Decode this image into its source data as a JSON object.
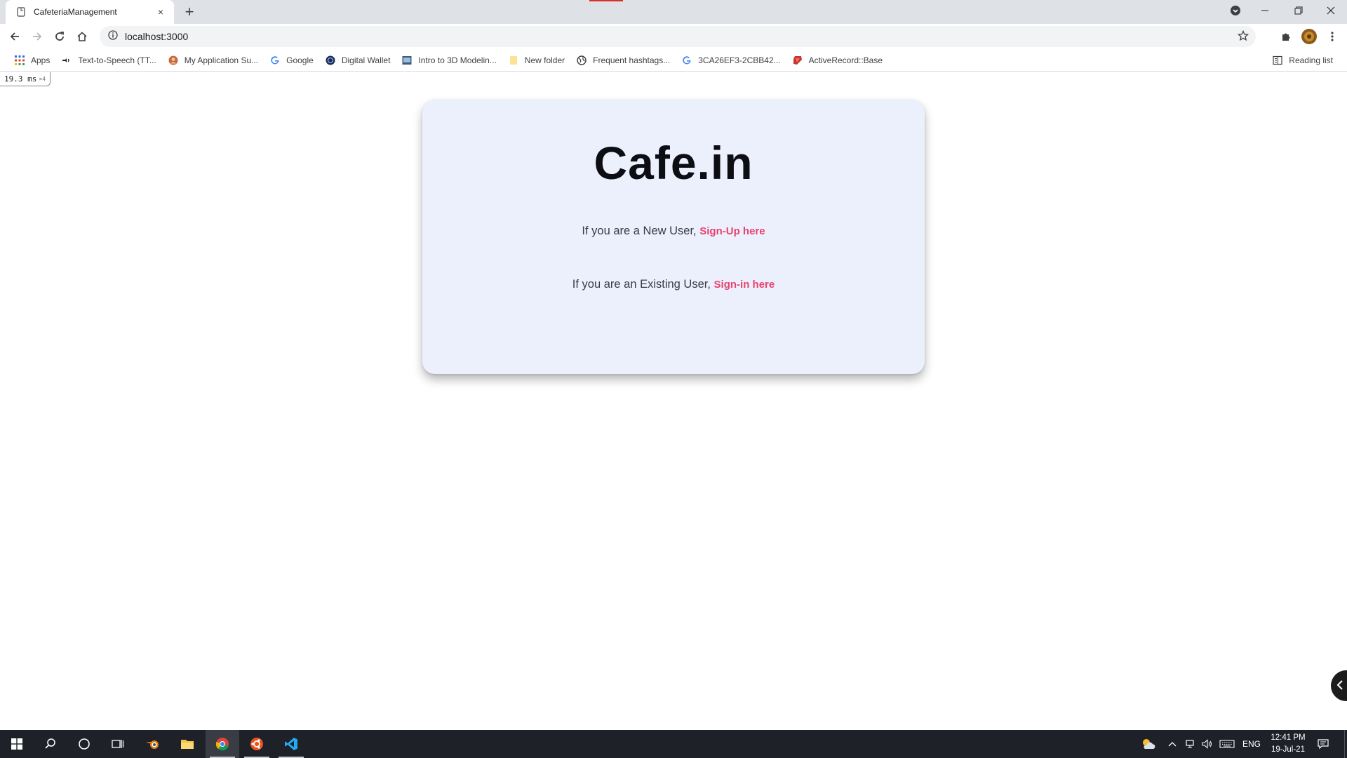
{
  "browser": {
    "tab": {
      "title": "CafeteriaManagement",
      "close": "×"
    },
    "new_tab": "+",
    "address": "localhost:3000",
    "bookmarks": [
      {
        "label": "Apps",
        "icon": "apps-grid-icon"
      },
      {
        "label": "Text-to-Speech (TT...",
        "icon": "tts-icon"
      },
      {
        "label": "My Application Su...",
        "icon": "avatar-icon"
      },
      {
        "label": "Google",
        "icon": "google-icon"
      },
      {
        "label": "Digital Wallet",
        "icon": "wallet-icon"
      },
      {
        "label": "Intro to 3D Modelin...",
        "icon": "slides-icon"
      },
      {
        "label": "New folder",
        "icon": "folder-icon"
      },
      {
        "label": "Frequent hashtags...",
        "icon": "globe-icon"
      },
      {
        "label": "3CA26EF3-2CBB42...",
        "icon": "google-icon"
      },
      {
        "label": "ActiveRecord::Base",
        "icon": "ruby-icon"
      }
    ],
    "reading_list": "Reading list"
  },
  "perf_badge": {
    "time": "19.3",
    "unit": "ms",
    "count": "×4"
  },
  "page": {
    "brand": "Cafe.in",
    "new_user_text": "If you are a New User,",
    "signup_link": "Sign-Up here",
    "existing_user_text": "If you are an Existing User,",
    "signin_link": "Sign-in here"
  },
  "taskbar": {
    "language": "ENG",
    "time": "12:41 PM",
    "date": "19-Jul-21"
  },
  "colors": {
    "card_bg": "#ecf0fd",
    "link": "#e8436c",
    "brand_text": "#0d0d14",
    "taskbar_bg": "#1f2128"
  }
}
